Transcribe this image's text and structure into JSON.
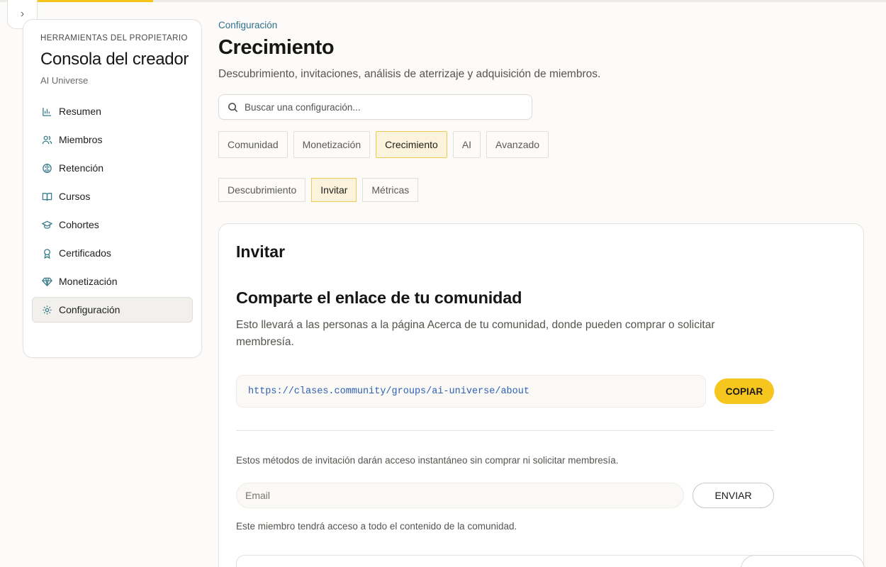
{
  "sidebar": {
    "kicker": "HERRAMIENTAS DEL PROPIETARIO",
    "title": "Consola del creador",
    "subtitle": "AI Universe",
    "items": [
      {
        "label": "Resumen",
        "icon": "bar-chart-icon"
      },
      {
        "label": "Miembros",
        "icon": "users-icon"
      },
      {
        "label": "Retención",
        "icon": "brain-icon"
      },
      {
        "label": "Cursos",
        "icon": "book-open-icon"
      },
      {
        "label": "Cohortes",
        "icon": "graduation-cap-icon"
      },
      {
        "label": "Certificados",
        "icon": "award-icon"
      },
      {
        "label": "Monetización",
        "icon": "gem-icon"
      },
      {
        "label": "Configuración",
        "icon": "gear-icon",
        "active": true
      }
    ]
  },
  "header": {
    "breadcrumb": "Configuración",
    "title": "Crecimiento",
    "description": "Descubrimiento, invitaciones, análisis de aterrizaje y adquisición de miembros.",
    "search_placeholder": "Buscar una configuración..."
  },
  "tabs": [
    "Comunidad",
    "Monetización",
    "Crecimiento",
    "AI",
    "Avanzado"
  ],
  "active_tab": "Crecimiento",
  "subtabs": [
    "Descubrimiento",
    "Invitar",
    "Métricas"
  ],
  "active_subtab": "Invitar",
  "card": {
    "title": "Invitar",
    "share_title": "Comparte el enlace de tu comunidad",
    "share_desc": "Esto llevará a las personas a la página Acerca de tu comunidad, donde pueden comprar o solicitar membresía.",
    "link": "https://clases.community/groups/ai-universe/about",
    "copy_label": "COPIAR",
    "invite_note": "Estos métodos de invitación darán acceso instantáneo sin comprar ni solicitar membresía.",
    "email_placeholder": "Email",
    "send_label": "ENVIAR",
    "member_note": "Este miembro tendrá acceso a todo el contenido de la comunidad."
  },
  "colors": {
    "accent": "#f6c61f",
    "link": "#2f6f89",
    "icon": "#3a7d8c"
  }
}
